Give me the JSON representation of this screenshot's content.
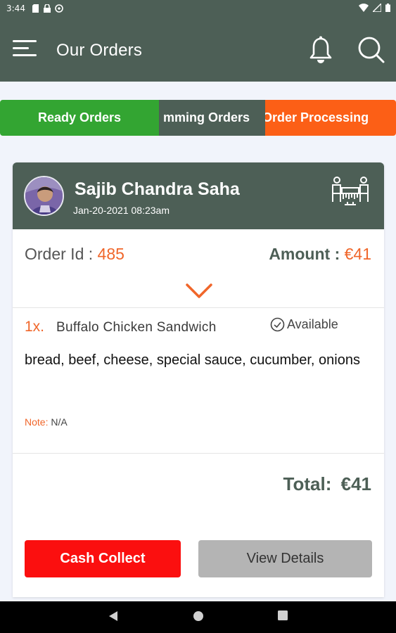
{
  "status_bar": {
    "time": "3:44",
    "icons": [
      "sd-card-icon",
      "lock-icon",
      "data-saver-icon",
      "wifi-icon",
      "signal-icon",
      "battery-icon"
    ]
  },
  "app_bar": {
    "title": "Our Orders",
    "icons": [
      "menu-icon",
      "bell-icon",
      "search-icon"
    ]
  },
  "tabs": [
    {
      "label": "Ready Orders",
      "color": "#33a532"
    },
    {
      "label": "mming  Orders",
      "color": "#4d5f56"
    },
    {
      "label": "Order Processing",
      "color": "#fc5f16"
    }
  ],
  "order": {
    "customer_name": "Sajib Chandra Saha",
    "date": "Jan-20-2021 08:23am",
    "order_id_label": "Order Id : ",
    "order_id": "485",
    "amount_label": "Amount : ",
    "amount": "€41",
    "order_type_icon": "dine-in-table-icon",
    "items": [
      {
        "qty": "1x.",
        "name": "Buffalo Chicken Sandwich",
        "status": "Available",
        "ingredients": "bread, beef, cheese, special sauce, cucumber, onions",
        "note_label": "Note: ",
        "note": "N/A"
      }
    ],
    "total_label": "Total:",
    "total": "€41"
  },
  "buttons": {
    "cash_collect": "Cash Collect",
    "view_details": "View Details"
  },
  "colors": {
    "primary": "#4d5f56",
    "accent": "#f0662a",
    "green": "#33a532",
    "red": "#fb0f0f"
  }
}
